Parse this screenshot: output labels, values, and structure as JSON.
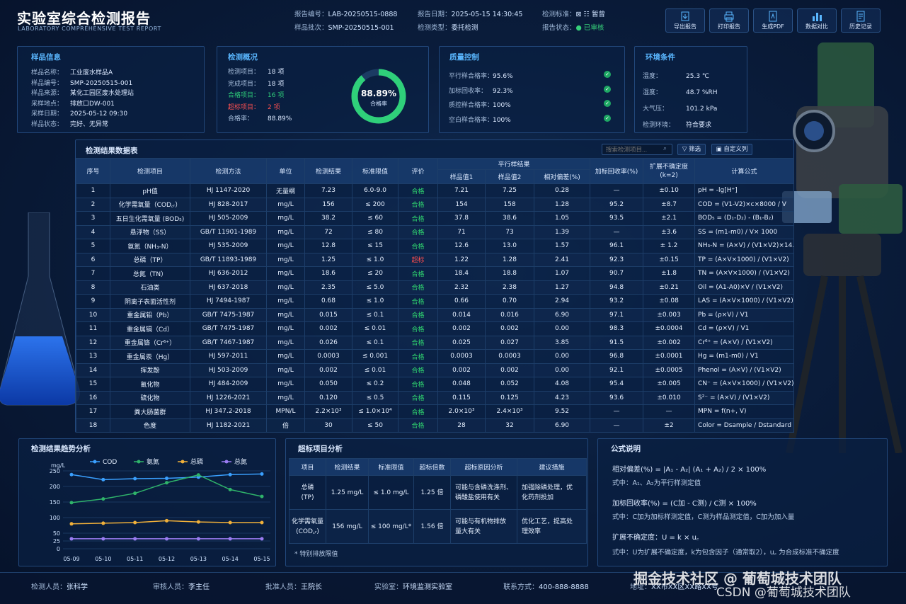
{
  "header": {
    "title": "实验室综合检测报告",
    "subtitle": "LABORATORY COMPREHENSIVE TEST REPORT",
    "report_no_k": "报告编号：",
    "report_no": "LAB-20250515-0888",
    "batch_k": "样品批次：",
    "batch": "SMP-20250515-001",
    "date_k": "报告日期：",
    "date": "2025-05-15 14:30:45",
    "type_k": "检测类型：",
    "type": "委托检测",
    "std_k": "检测标准：",
    "std": "⊠ ☷ 暂曾",
    "status_k": "报告状态：",
    "status": "● 已审核"
  },
  "toolbar": [
    {
      "label": "导出报告",
      "icon": "export-icon"
    },
    {
      "label": "打印报告",
      "icon": "print-icon"
    },
    {
      "label": "生成PDF",
      "icon": "pdf-icon"
    },
    {
      "label": "数据对比",
      "icon": "compare-icon"
    },
    {
      "label": "历史记录",
      "icon": "history-icon"
    }
  ],
  "sample": {
    "title": "样品信息",
    "items": [
      {
        "k": "样品名称：",
        "v": "工业废水样品A"
      },
      {
        "k": "样品编号：",
        "v": "SMP-20250515-001"
      },
      {
        "k": "样品来源：",
        "v": "某化工园区废水处理站"
      },
      {
        "k": "采样地点：",
        "v": "排放口DW-001"
      },
      {
        "k": "采样日期：",
        "v": "2025-05-12 09:30"
      },
      {
        "k": "样品状态：",
        "v": "完好、无异常"
      }
    ]
  },
  "overview": {
    "title": "检测概况",
    "items": [
      {
        "k": "检测项目：",
        "v": "18  项"
      },
      {
        "k": "完成项目：",
        "v": "18  项"
      },
      {
        "k": "合格项目：",
        "v": "16  项"
      },
      {
        "k": "超标项目：",
        "v": "2   项"
      },
      {
        "k": "合格率：",
        "v": "88.89%"
      }
    ],
    "ring_value": "88.89%",
    "ring_label": "合格率",
    "ring_fraction": 0.8889,
    "ring_color": "#2fd07a"
  },
  "qc": {
    "title": "质量控制",
    "items": [
      {
        "k": "平行样合格率：",
        "v": "95.6%"
      },
      {
        "k": "加标回收率：",
        "v": "92.3%"
      },
      {
        "k": "质控样合格率：",
        "v": "100%"
      },
      {
        "k": "空白样合格率：",
        "v": "100%"
      }
    ]
  },
  "env": {
    "title": "环境条件",
    "items": [
      {
        "k": "温度：",
        "v": "25.3 ℃"
      },
      {
        "k": "湿度：",
        "v": "48.7 %RH"
      },
      {
        "k": "大气压：",
        "v": "101.2 kPa"
      },
      {
        "k": "检测环境：",
        "v": "符合要求"
      }
    ]
  },
  "results": {
    "title": "检测结果数据表",
    "search_placeholder": "搜索检测项目...",
    "filter": "筛选",
    "custom": "自定义列",
    "headers": {
      "no": "序号",
      "item": "检测项目",
      "method": "检测方法",
      "unit": "单位",
      "result": "检测结果",
      "limit": "标准限值",
      "eval": "评价",
      "parallel": "平行样结果",
      "s1": "样品值1",
      "s2": "样品值2",
      "dev": "相对偏差(%)",
      "rec": "加标回收率(%)",
      "unc": "扩展不确定度\n(k=2)",
      "formula": "计算公式"
    },
    "rows": [
      [
        "1",
        "pH值",
        "HJ 1147-2020",
        "无量纲",
        "7.23",
        "6.0-9.0",
        "合格",
        "7.21",
        "7.25",
        "0.28",
        "—",
        "±0.10",
        "pH = -lg[H⁺]"
      ],
      [
        "2",
        "化学需氧量（COD꜀ᵣ）",
        "HJ 828-2017",
        "mg/L",
        "156",
        "≤ 200",
        "合格",
        "154",
        "158",
        "1.28",
        "95.2",
        "±8.7",
        "COD = (V1-V2)×c×8000 / V"
      ],
      [
        "3",
        "五日生化需氧量 (BOD₅)",
        "HJ 505-2009",
        "mg/L",
        "38.2",
        "≤ 60",
        "合格",
        "37.8",
        "38.6",
        "1.05",
        "93.5",
        "±2.1",
        "BOD₅ = (D₁-D₂) - (B₁-B₂)"
      ],
      [
        "4",
        "悬浮物（SS）",
        "GB/T 11901-1989",
        "mg/L",
        "72",
        "≤ 80",
        "合格",
        "71",
        "73",
        "1.39",
        "—",
        "±3.6",
        "SS = (m1-m0) / V× 1000"
      ],
      [
        "5",
        "氨氮（NH₃-N）",
        "HJ 535-2009",
        "mg/L",
        "12.8",
        "≤ 15",
        "合格",
        "12.6",
        "13.0",
        "1.57",
        "96.1",
        "± 1.2",
        "NH₃-N = (A×V) / (V1×V2)×14.01"
      ],
      [
        "6",
        "总磷（TP）",
        "GB/T 11893-1989",
        "mg/L",
        "1.25",
        "≤ 1.0",
        "超标",
        "1.22",
        "1.28",
        "2.41",
        "92.3",
        "±0.15",
        "TP = (A×V×1000) / (V1×V2)"
      ],
      [
        "7",
        "总氮（TN）",
        "HJ 636-2012",
        "mg/L",
        "18.6",
        "≤ 20",
        "合格",
        "18.4",
        "18.8",
        "1.07",
        "90.7",
        "±1.8",
        "TN = (A×V×1000) / (V1×V2)"
      ],
      [
        "8",
        "石油类",
        "HJ 637-2018",
        "mg/L",
        "2.35",
        "≤ 5.0",
        "合格",
        "2.32",
        "2.38",
        "1.27",
        "94.8",
        "±0.21",
        "Oil = (A1-A0)×V / (V1×V2)"
      ],
      [
        "9",
        "阴离子表面活性剂",
        "HJ 7494-1987",
        "mg/L",
        "0.68",
        "≤ 1.0",
        "合格",
        "0.66",
        "0.70",
        "2.94",
        "93.2",
        "±0.08",
        "LAS = (A×V×1000) / (V1×V2)"
      ],
      [
        "10",
        "重金属铅（Pb）",
        "GB/T 7475-1987",
        "mg/L",
        "0.015",
        "≤ 0.1",
        "合格",
        "0.014",
        "0.016",
        "6.90",
        "97.1",
        "±0.003",
        "Pb = (ρ×V) / V1"
      ],
      [
        "11",
        "重金属镉（Cd）",
        "GB/T 7475-1987",
        "mg/L",
        "0.002",
        "≤ 0.01",
        "合格",
        "0.002",
        "0.002",
        "0.00",
        "98.3",
        "±0.0004",
        "Cd = (ρ×V) / V1"
      ],
      [
        "12",
        "重金属铬（Cr⁶⁺）",
        "GB/T 7467-1987",
        "mg/L",
        "0.026",
        "≤ 0.1",
        "合格",
        "0.025",
        "0.027",
        "3.85",
        "91.5",
        "±0.002",
        "Cr⁶⁺ = (A×V) / (V1×V2)"
      ],
      [
        "13",
        "重金属汞（Hg）",
        "HJ 597-2011",
        "mg/L",
        "0.0003",
        "≤ 0.001",
        "合格",
        "0.0003",
        "0.0003",
        "0.00",
        "96.8",
        "±0.0001",
        "Hg = (m1-m0) / V1"
      ],
      [
        "14",
        "挥发酚",
        "HJ 503-2009",
        "mg/L",
        "0.002",
        "≤ 0.01",
        "合格",
        "0.002",
        "0.002",
        "0.00",
        "92.1",
        "±0.0005",
        "Phenol = (A×V)  /  (V1×V2)"
      ],
      [
        "15",
        "氰化物",
        "HJ 484-2009",
        "mg/L",
        "0.050",
        "≤ 0.2",
        "合格",
        "0.048",
        "0.052",
        "4.08",
        "95.4",
        "±0.005",
        "CN⁻ = (A×V×1000) / (V1×V2)"
      ],
      [
        "16",
        "硫化物",
        "HJ 1226-2021",
        "mg/L",
        "0.120",
        "≤ 0.5",
        "合格",
        "0.115",
        "0.125",
        "4.23",
        "93.6",
        "±0.010",
        "S²⁻ = (A×V) / (V1×V2)"
      ],
      [
        "17",
        "粪大肠菌群",
        "HJ 347.2-2018",
        "MPN/L",
        "2.2×10³",
        "≤ 1.0×10⁴",
        "合格",
        "2.0×10³",
        "2.4×10³",
        "9.52",
        "—",
        "—",
        "MPN = f(n+, V)"
      ],
      [
        "18",
        "色度",
        "HJ 1182-2021",
        "倍",
        "30",
        "≤ 50",
        "合格",
        "28",
        "32",
        "6.90",
        "—",
        "±2",
        "Color = Dsample / Dstandard × N"
      ]
    ]
  },
  "trend": {
    "title": "检测结果趋势分析"
  },
  "chart_data": {
    "type": "line",
    "title": "",
    "xlabel": "",
    "ylabel": "mg/L",
    "categories": [
      "05-09",
      "05-10",
      "05-11",
      "05-12",
      "05-13",
      "05-14",
      "05-15"
    ],
    "ylim": [
      0,
      250
    ],
    "yticks": [
      0,
      25,
      50,
      100,
      150,
      200,
      250
    ],
    "legend": "top",
    "grid": true,
    "series": [
      {
        "name": "COD",
        "color": "#3aa0ff",
        "values": [
          238,
          222,
          225,
          226,
          230,
          238,
          240
        ]
      },
      {
        "name": "氨氮",
        "color": "#2fb36a",
        "values": [
          148,
          160,
          178,
          212,
          237,
          190,
          168
        ]
      },
      {
        "name": "总磷",
        "color": "#f0b03a",
        "values": [
          80,
          82,
          84,
          90,
          86,
          84,
          84
        ]
      },
      {
        "name": "总氮",
        "color": "#9a7cf2",
        "values": [
          32,
          32,
          32,
          32,
          32,
          32,
          32
        ]
      }
    ]
  },
  "exceed": {
    "title": "超标项目分析",
    "headers": [
      "项目",
      "检测结果",
      "标准限值",
      "超标倍数",
      "超标原因分析",
      "建议措施"
    ],
    "rows": [
      [
        "总磷\n(TP)",
        "1.25 mg/L",
        "≤ 1.0 mg/L",
        "1.25 倍",
        "可能与含磷洗涤剂、\n磷酸盐使用有关",
        "加强除磷处理，优\n化药剂投加"
      ],
      [
        "化学需氧量\n(COD꜀ᵣ)",
        "156 mg/L",
        "≤ 100 mg/L*",
        "1.56 倍",
        "可能与有机物排放\n量大有关",
        "优化工艺，提高处\n理效率"
      ]
    ],
    "note": "* 特别排放限值"
  },
  "formula": {
    "title": "公式说明",
    "f1": "相对偏差(%) = |A₁ - A₂| (A₁ + A₂) / 2 × 100%",
    "f1n": "式中：A₁、A₂为平行样测定值",
    "f2": "加标回收率(%) = (C加 - C测) / C测 × 100%",
    "f2n": "式中：C加为加标样测定值，C测为样品测定值，C加为加入量",
    "f3": "扩展不确定度：U = k × u꜀",
    "f3n": "式中：U为扩展不确定度，k为包含因子（通常取2），u꜀ 为合成标准不确定度"
  },
  "footer": [
    {
      "k": "检测人员：",
      "v": "张科学"
    },
    {
      "k": "审核人员：",
      "v": "李主任"
    },
    {
      "k": "批准人员：",
      "v": "王院长"
    },
    {
      "k": "实验室：",
      "v": "环境监测实验室"
    },
    {
      "k": "联系方式：",
      "v": "400-888-8888"
    },
    {
      "k": "地址：",
      "v": "XX市XX区XX路XX号"
    }
  ],
  "watermark": {
    "line1": "掘金技术社区 @ 葡萄城技术团队",
    "line2": "CSDN @葡萄城技术团队"
  }
}
